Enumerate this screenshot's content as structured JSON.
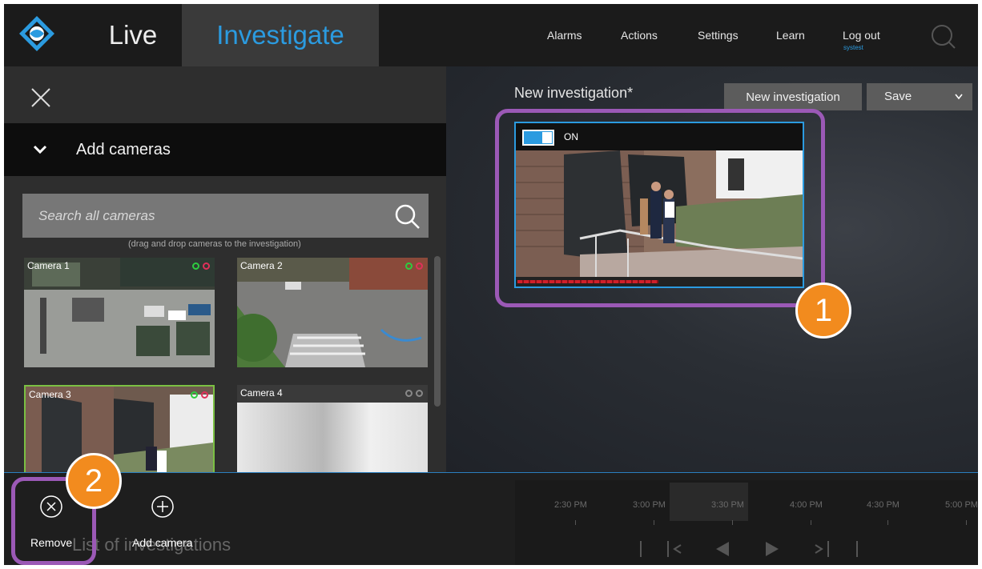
{
  "topbar": {
    "logo": "milestone-logo-icon",
    "tabs": [
      {
        "label": "Live",
        "active": false
      },
      {
        "label": "Investigate",
        "active": true
      }
    ],
    "menu": [
      "Alarms",
      "Actions",
      "Settings",
      "Learn",
      "Log out"
    ],
    "user": "systest",
    "search_icon": "search-icon"
  },
  "left_panel": {
    "close_icon": "close-icon",
    "section_title": "Add cameras",
    "search_placeholder": "Search all cameras",
    "drag_hint": "(drag and drop cameras to the investigation)",
    "cameras": [
      {
        "name": "Camera 1",
        "status": [
          "green",
          "red"
        ],
        "selected": false
      },
      {
        "name": "Camera 2",
        "status": [
          "green",
          "red"
        ],
        "selected": false
      },
      {
        "name": "Camera 3",
        "status": [
          "green",
          "red"
        ],
        "selected": true
      },
      {
        "name": "Camera 4",
        "status": [
          "gray",
          "gray"
        ],
        "selected": false
      }
    ]
  },
  "investigation": {
    "title": "New investigation*",
    "new_button": "New investigation",
    "save_button": "Save",
    "tile_toggle_label": "ON",
    "tile_toggle_on": true
  },
  "callouts": [
    "1",
    "2"
  ],
  "bottom": {
    "actions": [
      {
        "label": "Remove",
        "icon": "remove-circle-icon"
      },
      {
        "label": "Add camera",
        "icon": "add-circle-icon"
      }
    ],
    "background_text": "List of investigations",
    "timeline_labels": [
      "2:30 PM",
      "3:00 PM",
      "3:30 PM",
      "4:00 PM",
      "4:30 PM",
      "5:00 PM"
    ],
    "colors": {
      "accent": "#2b9be0",
      "highlight": "#9b59b6",
      "badge": "#f28b1e"
    }
  }
}
